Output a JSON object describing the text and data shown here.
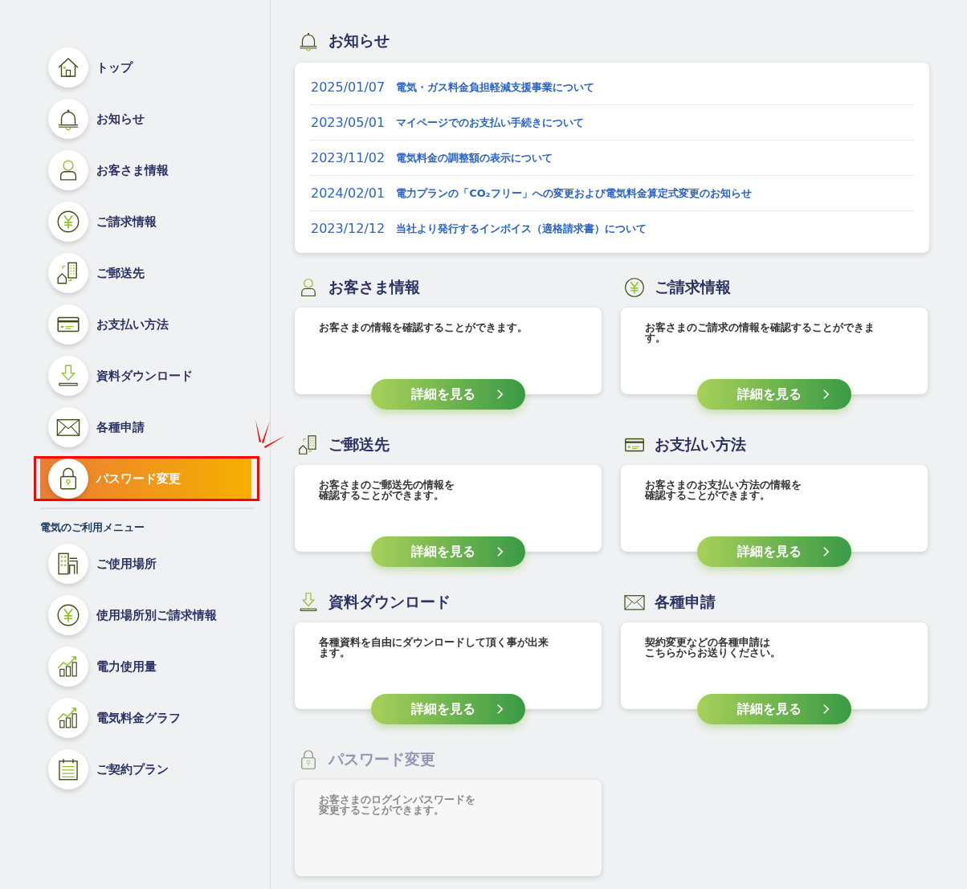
{
  "sidebar": {
    "items": [
      {
        "label": "トップ",
        "selected": false,
        "highlighted": false
      },
      {
        "label": "お知らせ",
        "selected": false,
        "highlighted": false
      },
      {
        "label": "お客さま情報",
        "selected": false,
        "highlighted": false
      },
      {
        "label": "ご請求情報",
        "selected": false,
        "highlighted": false
      },
      {
        "label": "ご郵送先",
        "selected": false,
        "highlighted": false
      },
      {
        "label": "お支払い方法",
        "selected": false,
        "highlighted": false
      },
      {
        "label": "資料ダウンロード",
        "selected": false,
        "highlighted": false
      },
      {
        "label": "各種申請",
        "selected": false,
        "highlighted": false
      },
      {
        "label": "パスワード変更",
        "selected": true,
        "highlighted": true
      }
    ],
    "section_title": "電気のご利用メニュー",
    "usage_items": [
      {
        "label": "ご使用場所",
        "selected": false
      },
      {
        "label": "使用場所別ご請求情報",
        "selected": false
      },
      {
        "label": "電力使用量",
        "selected": false
      },
      {
        "label": "電気料金グラフ",
        "selected": false
      },
      {
        "label": "ご契約プラン",
        "selected": false
      }
    ]
  },
  "news": {
    "title": "お知らせ",
    "items": [
      {
        "date": "2025/01/07",
        "title": "電気・ガス料金負担軽減支援事業について"
      },
      {
        "date": "2023/05/01",
        "title": "マイページでのお支払い手続きについて"
      },
      {
        "date": "2023/11/02",
        "title": "電気料金の調整額の表示について"
      },
      {
        "date": "2024/02/01",
        "title": "電力プランの「CO₂フリー」への変更および電気料金算定式変更のお知らせ"
      },
      {
        "date": "2023/12/12",
        "title": "当社より発行するインボイス（適格請求書）について"
      }
    ]
  },
  "cards": [
    {
      "title": "お客さま情報",
      "lines": [
        "お客さまの情報を確認することができます。"
      ],
      "button": "詳細を見る",
      "disabled": false
    },
    {
      "title": "ご請求情報",
      "lines": [
        "お客さまのご請求の情報を確認することができま",
        "す。"
      ],
      "button": "詳細を見る",
      "disabled": false
    },
    {
      "title": "ご郵送先",
      "lines": [
        "お客さまのご郵送先の情報を",
        "確認することができます。"
      ],
      "button": "詳細を見る",
      "disabled": false
    },
    {
      "title": "お支払い方法",
      "lines": [
        "お客さまのお支払い方法の情報を",
        "確認することができます。"
      ],
      "button": "詳細を見る",
      "disabled": false
    },
    {
      "title": "資料ダウンロード",
      "lines": [
        "各種資料を自由にダウンロードして頂く事が出来",
        "ます。"
      ],
      "button": "詳細を見る",
      "disabled": false
    },
    {
      "title": "各種申請",
      "lines": [
        "契約変更などの各種申請は",
        "こちらからお送りください。"
      ],
      "button": "詳細を見る",
      "disabled": false
    },
    {
      "title": "パスワード変更",
      "lines": [
        "お客さまのログインパスワードを",
        "変更することができます。"
      ],
      "disabled": true
    }
  ]
}
